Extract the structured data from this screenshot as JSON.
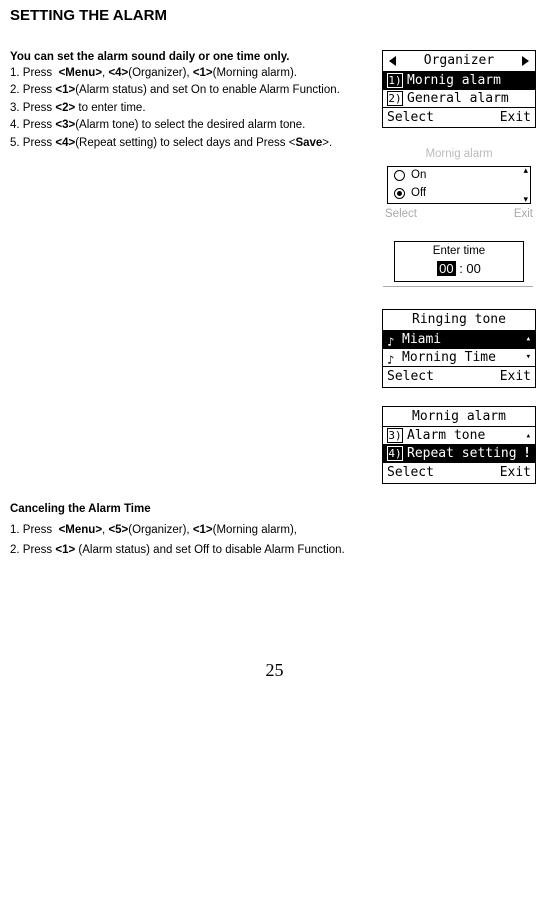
{
  "title": "SETTING THE ALARM",
  "intro": "You can set the alarm sound daily or one time only.",
  "steps": [
    "1. Press  <Menu>, <4>(Organizer), <1>(Morning alarm).",
    "2. Press <1>(Alarm status) and set On to enable Alarm Function.",
    "3. Press <2> to enter time.",
    "4. Press <3>(Alarm tone) to select the desired alarm tone.",
    "5. Press <4>(Repeat setting) to select days and Press <Save>."
  ],
  "screens": {
    "organizer": {
      "header": "Organizer",
      "item1_num": "1)",
      "item1_label": "Mornig alarm",
      "item2_num": "2)",
      "item2_label": "General alarm",
      "soft_left": "Select",
      "soft_right": "Exit"
    },
    "mornig_onoff": {
      "title": "Mornig alarm",
      "opt_on": "On",
      "opt_off": "Off",
      "soft_left": "Select",
      "soft_right": "Exit"
    },
    "enter_time": {
      "label": "Enter time",
      "hh": "00",
      "sep": ":",
      "mm": "00"
    },
    "ringing": {
      "header": "Ringing tone",
      "item1": "Miami",
      "item2": "Morning Time",
      "soft_left": "Select",
      "soft_right": "Exit"
    },
    "repeat": {
      "header": "Mornig alarm",
      "item3_num": "3)",
      "item3_label": "Alarm tone",
      "item4_num": "4)",
      "item4_label": "Repeat setting",
      "soft_left": "Select",
      "soft_right": "Exit"
    }
  },
  "cancel": {
    "title": "Canceling the Alarm Time",
    "steps": [
      "1. Press  <Menu>, <5>(Organizer), <1>(Morning alarm),",
      "2. Press <1> (Alarm status) and set Off to disable Alarm Function."
    ]
  },
  "page_number": "25"
}
